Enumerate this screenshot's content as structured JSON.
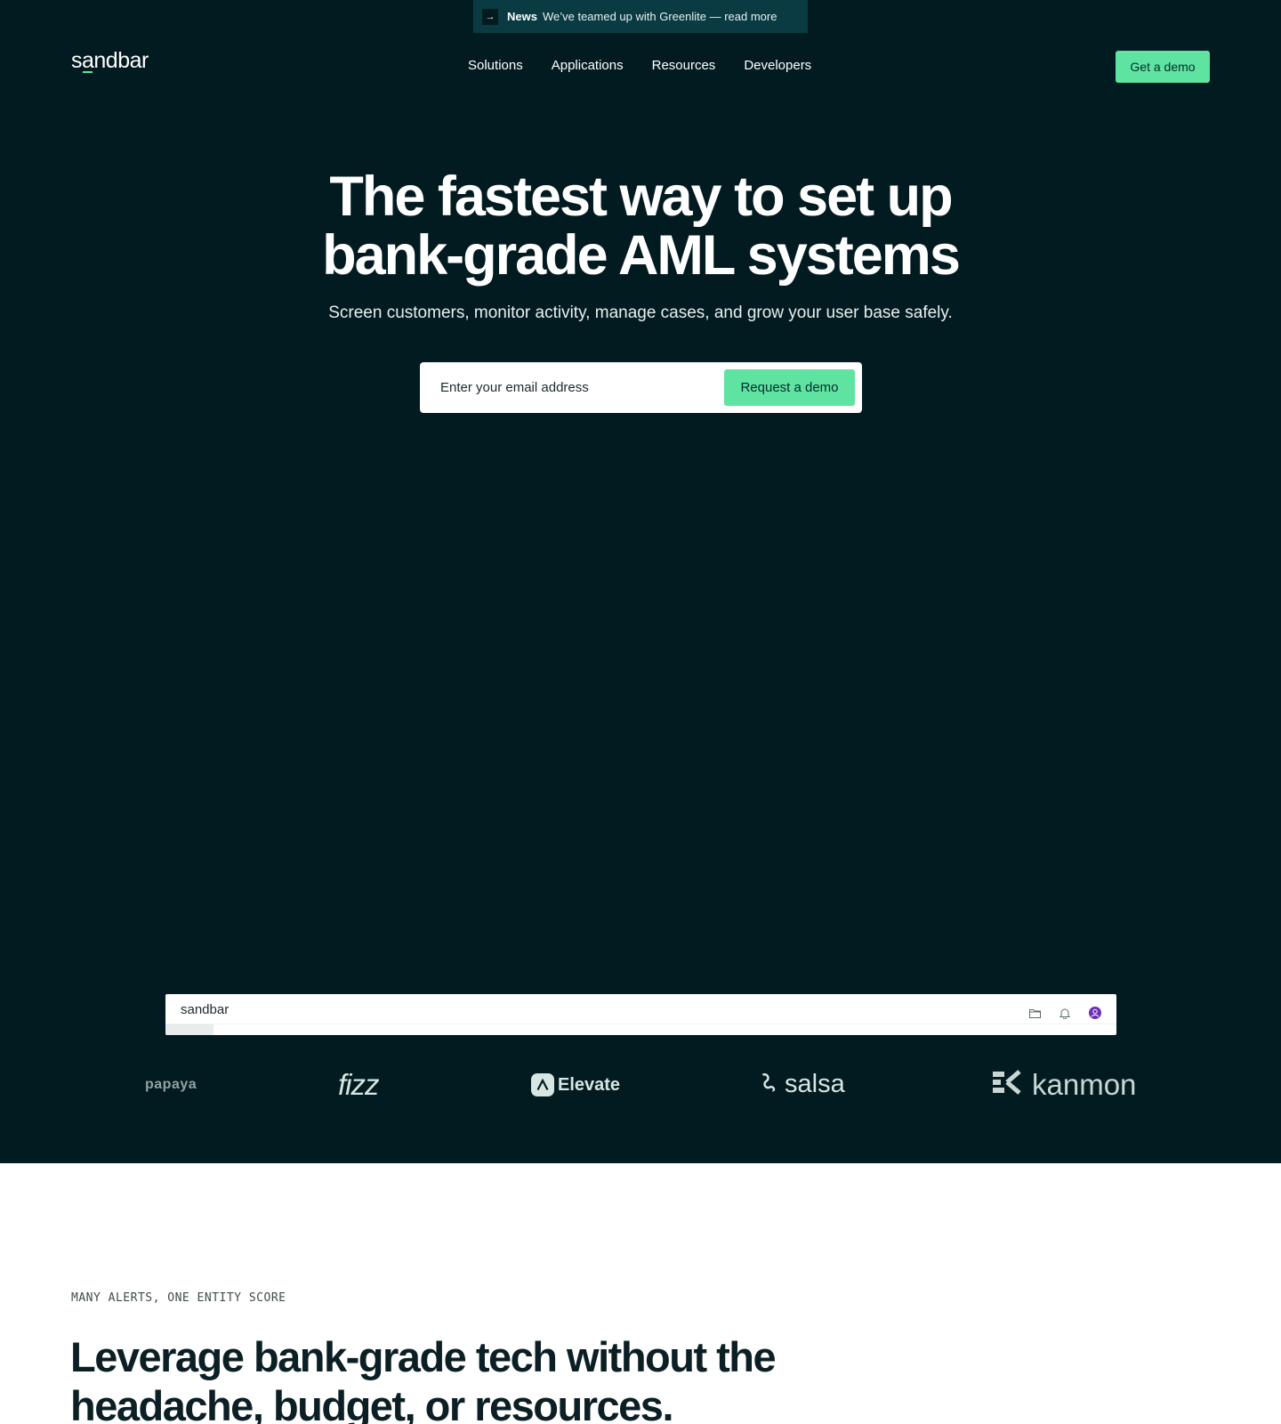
{
  "news": {
    "arrow": "→",
    "label": "News",
    "text": "We’ve teamed up with Greenlite — read more"
  },
  "header": {
    "logo": {
      "prefix": "s",
      "underlined": "a",
      "suffix": "ndbar"
    },
    "nav": [
      "Solutions",
      "Applications",
      "Resources",
      "Developers"
    ],
    "cta": "Get a demo"
  },
  "hero": {
    "title_line1": "The fastest way to set up",
    "title_line2": "bank-grade AML systems",
    "subtitle": "Screen customers, monitor activity, manage cases, and grow your user base safely.",
    "email_placeholder": "Enter your email address",
    "submit_label": "Request a demo"
  },
  "app_preview": {
    "logo": "sandbar",
    "icons": [
      "folder-icon",
      "bell-icon",
      "avatar-icon"
    ]
  },
  "customer_logos": {
    "papaya": "papaya",
    "fizz": "fizz",
    "elevate": "Elevate",
    "salsa": "salsa",
    "kanmon": "kanmon"
  },
  "section": {
    "eyebrow": "MANY ALERTS, ONE ENTITY SCORE",
    "title_line1": "Leverage bank-grade tech without the",
    "title_line2": "headache, budget, or resources."
  },
  "colors": {
    "hero_bg": "#021b20",
    "accent": "#5fe3a1",
    "news_bg": "#0a3b42",
    "avatar": "#6b2fb3"
  }
}
